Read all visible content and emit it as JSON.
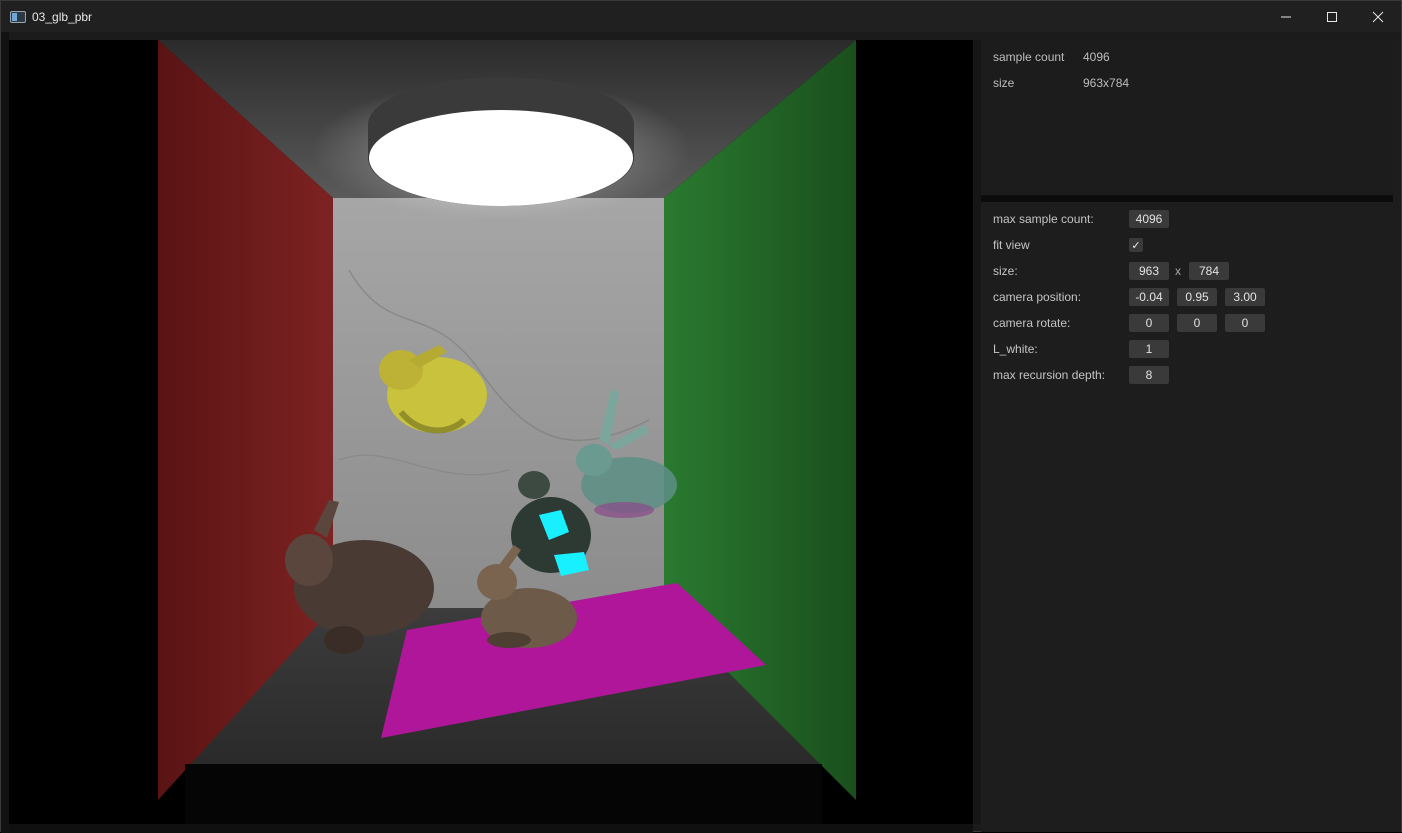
{
  "window": {
    "title": "03_glb_pbr"
  },
  "icons": {
    "app": "app-window-icon",
    "minimize": "minimize-icon",
    "maximize": "maximize-icon",
    "close": "close-icon",
    "check": "checkmark-icon"
  },
  "info": {
    "sample_count_label": "sample count",
    "sample_count_value": "4096",
    "size_label": "size",
    "size_value": "963x784"
  },
  "params": {
    "max_sample_count": {
      "label": "max sample count:",
      "value": "4096"
    },
    "fit_view": {
      "label": "fit view",
      "checked": true,
      "check_glyph": "✓"
    },
    "size": {
      "label": "size:",
      "width": "963",
      "separator": "x",
      "height": "784"
    },
    "camera_position": {
      "label": "camera position:",
      "x": "-0.04",
      "y": "0.95",
      "z": "3.00"
    },
    "camera_rotate": {
      "label": "camera rotate:",
      "x": "0",
      "y": "0",
      "z": "0"
    },
    "l_white": {
      "label": "L_white:",
      "value": "1"
    },
    "max_recursion_depth": {
      "label": "max recursion depth:",
      "value": "8"
    }
  },
  "colors": {
    "left_wall": "#7a1e1e",
    "right_wall": "#1f6a26",
    "floor_plane": "#b0169a",
    "bunny_yellow": "#c8c23c",
    "bunny_glass": "#5c8f86",
    "bunny_cyan_accent": "#19f0ff",
    "bunny_bronze": "#7a5e4a"
  }
}
